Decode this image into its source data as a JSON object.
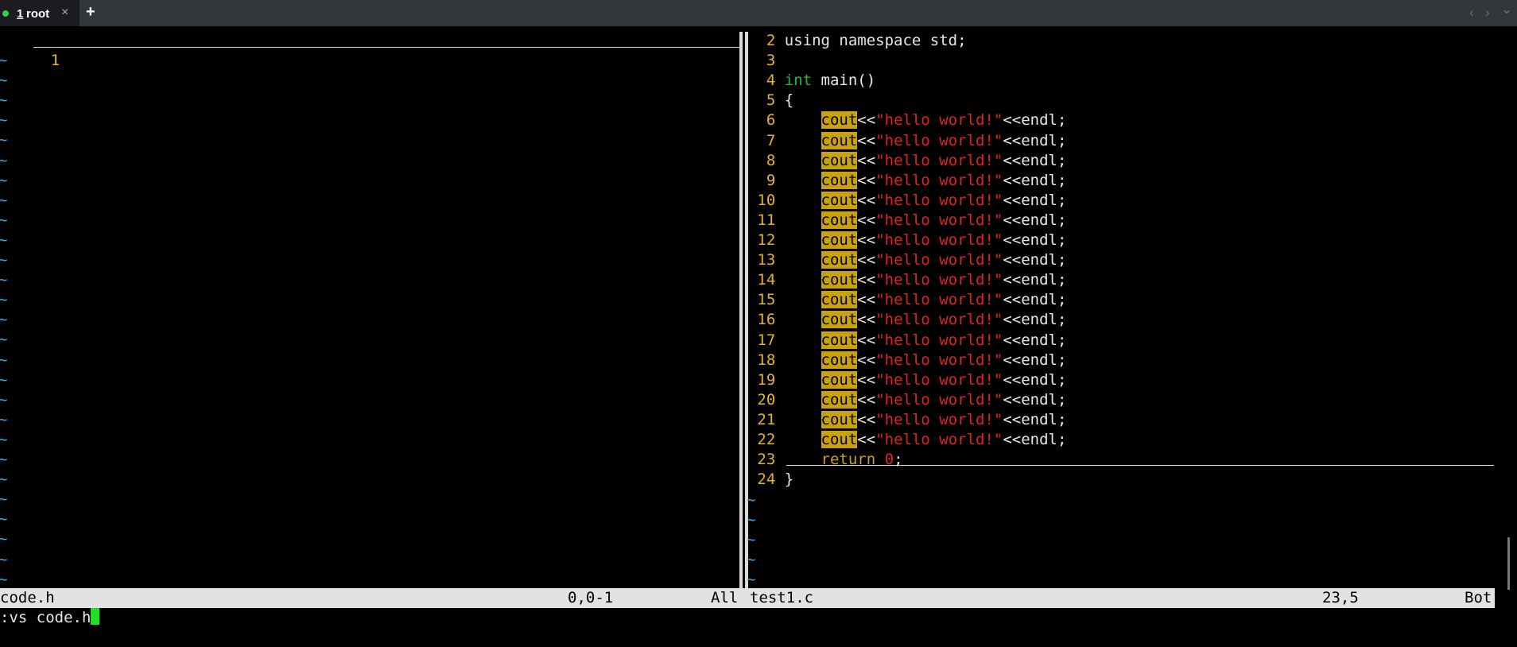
{
  "tabbar": {
    "tab": {
      "number": "1",
      "title": "root",
      "close": "×"
    },
    "add": "+",
    "nav_prev": "‹",
    "nav_next": "›",
    "nav_menu": "⌄"
  },
  "left_pane": {
    "line_number": "1",
    "tilde": "~"
  },
  "right_pane": {
    "lines": [
      {
        "n": "2",
        "t": "using namespace std;"
      },
      {
        "n": "3",
        "t": ""
      },
      {
        "n": "4",
        "type": "int",
        "t": " main()"
      },
      {
        "n": "5",
        "t": "{"
      },
      {
        "n": "6",
        "kw": "cout",
        "op": "<<",
        "str": "\"hello world!\"",
        "tail": "<<endl;"
      },
      {
        "n": "7",
        "kw": "cout",
        "op": "<<",
        "str": "\"hello world!\"",
        "tail": "<<endl;"
      },
      {
        "n": "8",
        "kw": "cout",
        "op": "<<",
        "str": "\"hello world!\"",
        "tail": "<<endl;"
      },
      {
        "n": "9",
        "kw": "cout",
        "op": "<<",
        "str": "\"hello world!\"",
        "tail": "<<endl;"
      },
      {
        "n": "10",
        "kw": "cout",
        "op": "<<",
        "str": "\"hello world!\"",
        "tail": "<<endl;"
      },
      {
        "n": "11",
        "kw": "cout",
        "op": "<<",
        "str": "\"hello world!\"",
        "tail": "<<endl;"
      },
      {
        "n": "12",
        "kw": "cout",
        "op": "<<",
        "str": "\"hello world!\"",
        "tail": "<<endl;"
      },
      {
        "n": "13",
        "kw": "cout",
        "op": "<<",
        "str": "\"hello world!\"",
        "tail": "<<endl;"
      },
      {
        "n": "14",
        "kw": "cout",
        "op": "<<",
        "str": "\"hello world!\"",
        "tail": "<<endl;"
      },
      {
        "n": "15",
        "kw": "cout",
        "op": "<<",
        "str": "\"hello world!\"",
        "tail": "<<endl;"
      },
      {
        "n": "16",
        "kw": "cout",
        "op": "<<",
        "str": "\"hello world!\"",
        "tail": "<<endl;"
      },
      {
        "n": "17",
        "kw": "cout",
        "op": "<<",
        "str": "\"hello world!\"",
        "tail": "<<endl;"
      },
      {
        "n": "18",
        "kw": "cout",
        "op": "<<",
        "str": "\"hello world!\"",
        "tail": "<<endl;"
      },
      {
        "n": "19",
        "kw": "cout",
        "op": "<<",
        "str": "\"hello world!\"",
        "tail": "<<endl;"
      },
      {
        "n": "20",
        "kw": "cout",
        "op": "<<",
        "str": "\"hello world!\"",
        "tail": "<<endl;"
      },
      {
        "n": "21",
        "kw": "cout",
        "op": "<<",
        "str": "\"hello world!\"",
        "tail": "<<endl;"
      },
      {
        "n": "22",
        "kw": "cout",
        "op": "<<",
        "str": "\"hello world!\"",
        "tail": "<<endl;"
      },
      {
        "n": "23",
        "ret": "return",
        "zero": "0",
        "tail": ";"
      },
      {
        "n": "24",
        "t": "}"
      }
    ],
    "tilde": "~"
  },
  "statusbar": {
    "left_file": "code.h",
    "left_pos": "0,0-1",
    "left_scroll": "All",
    "right_file": "test1.c",
    "right_pos": "23,5",
    "right_scroll": "Bot"
  },
  "cmdline": ":vs code.h",
  "colors": {
    "line_number": "#e5b32a",
    "tilde": "#3ba7e0",
    "string": "#e02222",
    "type": "#2eb82e",
    "highlight": "#c9a20e",
    "cursor": "#21e021"
  }
}
